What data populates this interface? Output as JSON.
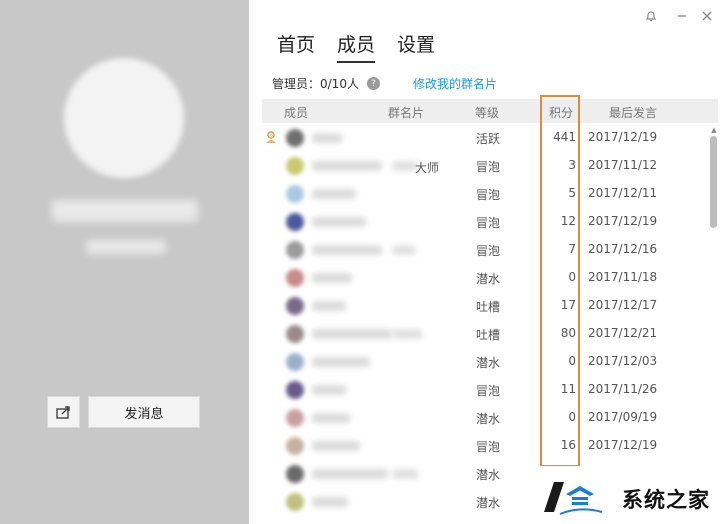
{
  "tabs": [
    {
      "label": "首页",
      "active": false
    },
    {
      "label": "成员",
      "active": true
    },
    {
      "label": "设置",
      "active": false
    }
  ],
  "admin": {
    "label": "管理员：0/10人",
    "rename_link": "修改我的群名片"
  },
  "left": {
    "send_label": "发消息",
    "share_icon": "share-icon"
  },
  "window_controls": [
    "bell-icon",
    "minimize-icon",
    "close-icon"
  ],
  "table": {
    "columns": [
      "成员",
      "群名片",
      "等级",
      "积分",
      "最后发言"
    ],
    "rows": [
      {
        "card_suffix": "",
        "level": "活跃",
        "points": "441",
        "last": "2017/12/19",
        "owner": true
      },
      {
        "card_suffix": "大师",
        "level": "冒泡",
        "points": "3",
        "last": "2017/11/12"
      },
      {
        "card_suffix": "",
        "level": "冒泡",
        "points": "5",
        "last": "2017/12/11"
      },
      {
        "card_suffix": "",
        "level": "冒泡",
        "points": "12",
        "last": "2017/12/19"
      },
      {
        "card_suffix": "",
        "level": "冒泡",
        "points": "7",
        "last": "2017/12/16"
      },
      {
        "card_suffix": "",
        "level": "潜水",
        "points": "0",
        "last": "2017/11/18"
      },
      {
        "card_suffix": "",
        "level": "吐槽",
        "points": "17",
        "last": "2017/12/17"
      },
      {
        "card_suffix": "",
        "level": "吐槽",
        "points": "80",
        "last": "2017/12/21"
      },
      {
        "card_suffix": "",
        "level": "潜水",
        "points": "0",
        "last": "2017/12/03"
      },
      {
        "card_suffix": "",
        "level": "冒泡",
        "points": "11",
        "last": "2017/11/26"
      },
      {
        "card_suffix": "",
        "level": "潜水",
        "points": "0",
        "last": "2017/09/19"
      },
      {
        "card_suffix": "",
        "level": "冒泡",
        "points": "16",
        "last": "2017/12/19"
      },
      {
        "card_suffix": "",
        "level": "潜水",
        "points": "",
        "last": ""
      },
      {
        "card_suffix": "",
        "level": "潜水",
        "points": "",
        "last": ""
      }
    ]
  },
  "highlight_color": "#e08a3a",
  "watermark": {
    "text": "系统之家"
  }
}
